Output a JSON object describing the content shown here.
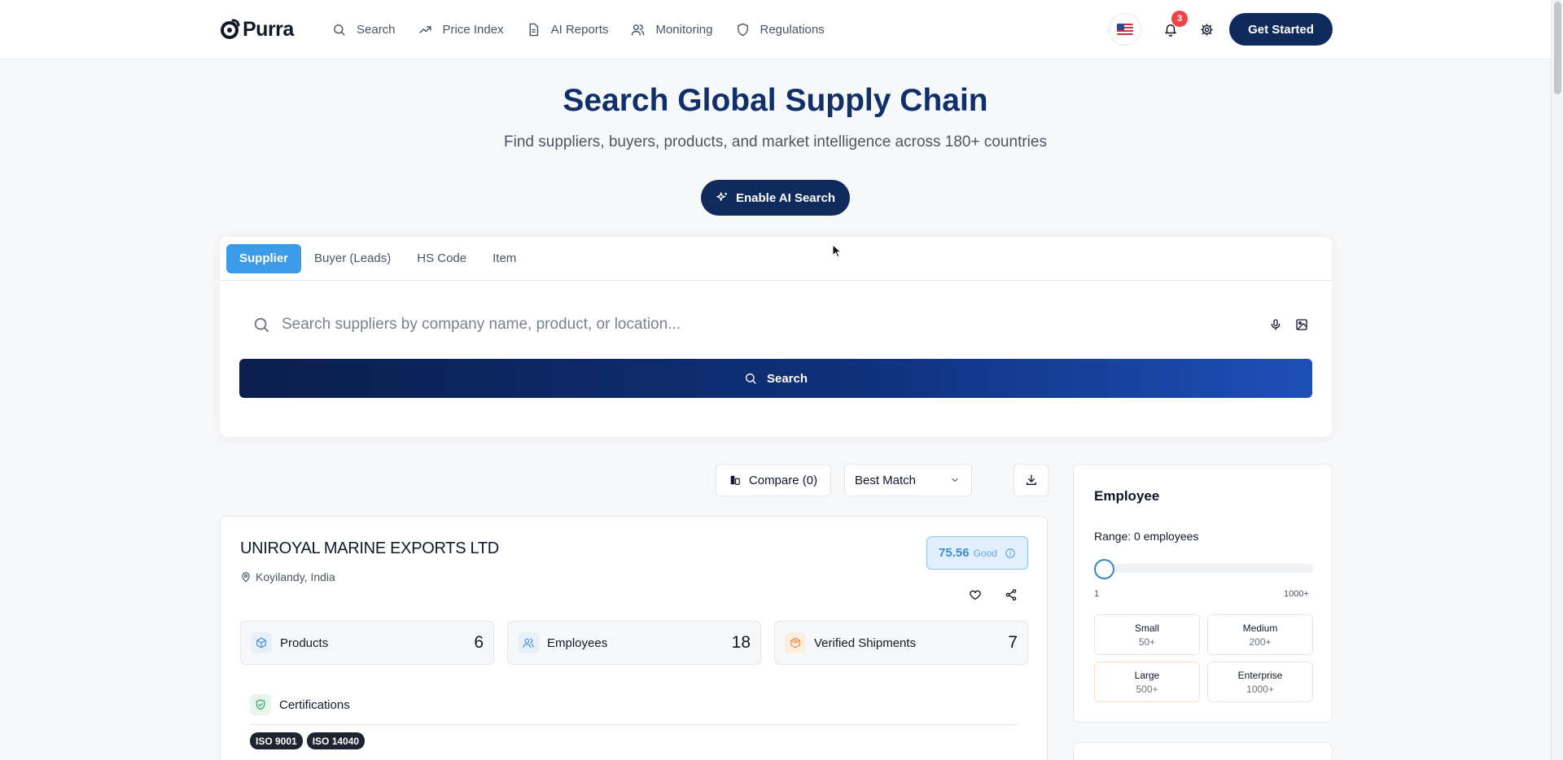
{
  "brand": {
    "name": "Purra"
  },
  "nav": {
    "items": [
      {
        "label": "Search",
        "icon": "search-icon"
      },
      {
        "label": "Price Index",
        "icon": "trending-up-icon"
      },
      {
        "label": "AI Reports",
        "icon": "document-icon"
      },
      {
        "label": "Monitoring",
        "icon": "users-icon"
      },
      {
        "label": "Regulations",
        "icon": "shield-icon"
      }
    ],
    "notification_count": "3",
    "language_flag": "us-flag-icon",
    "cta_label": "Get Started"
  },
  "hero": {
    "title": "Search Global Supply Chain",
    "subtitle": "Find suppliers, buyers, products, and market intelligence across 180+ countries",
    "ai_button_label": "Enable AI Search"
  },
  "search": {
    "tabs": [
      {
        "label": "Supplier",
        "active": true
      },
      {
        "label": "Buyer (Leads)",
        "active": false
      },
      {
        "label": "HS Code",
        "active": false
      },
      {
        "label": "Item",
        "active": false
      }
    ],
    "placeholder": "Search suppliers by company name, product, or location...",
    "value": "",
    "submit_label": "Search"
  },
  "toolbar": {
    "compare_label": "Compare (0)",
    "sort_selected": "Best Match"
  },
  "result": {
    "company_name": "UNIROYAL MARINE EXPORTS LTD",
    "location": "Koyilandy, India",
    "score_value": "75.56",
    "score_label": "Good",
    "stats": [
      {
        "label": "Products",
        "value": "6",
        "icon": "box-icon",
        "color": "#3b8ed6",
        "bg": "#e6f1fb"
      },
      {
        "label": "Employees",
        "value": "18",
        "icon": "users-icon",
        "color": "#3b8ed6",
        "bg": "#e6f1fb"
      },
      {
        "label": "Verified Shipments",
        "value": "7",
        "icon": "package-icon",
        "color": "#f08a3c",
        "bg": "#fdeee2"
      }
    ],
    "certifications_title": "Certifications",
    "certifications": [
      "ISO 9001",
      "ISO 14040"
    ]
  },
  "filter": {
    "title": "Employee",
    "range_text": "Range: 0 employees",
    "slider_value": 0,
    "range_min": "1",
    "range_max": "1000+",
    "sizes": [
      {
        "name": "Small",
        "count": "50+"
      },
      {
        "name": "Medium",
        "count": "200+"
      },
      {
        "name": "Large",
        "count": "500+"
      },
      {
        "name": "Enterprise",
        "count": "1000+"
      }
    ]
  },
  "colors": {
    "primary_navy": "#102a5c",
    "hero_title": "#10306b",
    "active_tab": "#3b9be8",
    "notification_badge": "#ef4444"
  }
}
